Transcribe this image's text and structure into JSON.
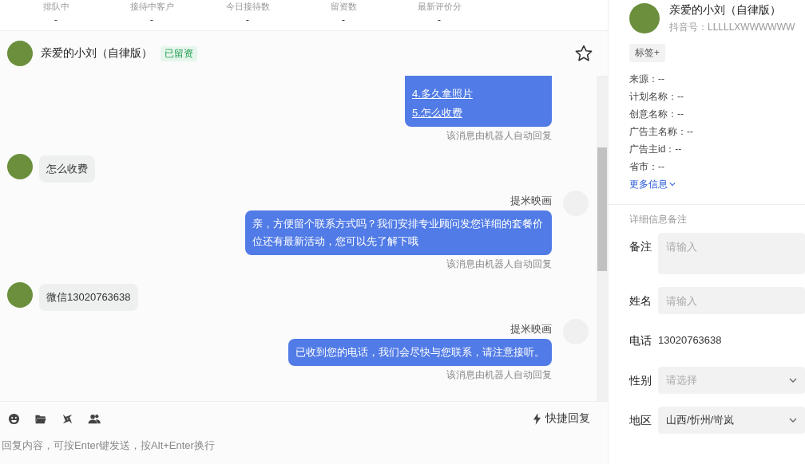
{
  "stats": [
    {
      "label": "排队中",
      "value": "-"
    },
    {
      "label": "接待中客户",
      "value": "-"
    },
    {
      "label": "今日接待数",
      "value": "-"
    },
    {
      "label": "留资数",
      "value": "-"
    },
    {
      "label": "最新评价分",
      "value": "-"
    }
  ],
  "chat_header": {
    "name": "亲爱的小刘（自律版）",
    "badge": "已留资",
    "starred": false
  },
  "messages": [
    {
      "kind": "menu",
      "items": [
        "4.多久拿照片",
        "5.怎么收费"
      ],
      "note": "该消息由机器人自动回复"
    },
    {
      "kind": "customer",
      "text": "怎么收费"
    },
    {
      "kind": "agent",
      "sender": "提米映画",
      "text": "亲，方便留个联系方式吗？我们安排专业顾问发您详细的套餐价位还有最新活动，您可以先了解下哦",
      "note": "该消息由机器人自动回复"
    },
    {
      "kind": "customer",
      "text": "微信13020763638"
    },
    {
      "kind": "agent",
      "sender": "提米映画",
      "text": "已收到您的电话，我们会尽快与您联系，请注意接听。",
      "note": "该消息由机器人自动回复"
    }
  ],
  "composer": {
    "quick_reply": "快捷回复",
    "placeholder": "回复内容，可按Enter键发送，按Alt+Enter换行"
  },
  "profile": {
    "name": "亲爱的小刘（自律版）",
    "douyin_id": "抖音号：LLLLLXWWWWWW",
    "tag_button": "标签+",
    "info": [
      "来源：--",
      "计划名称：--",
      "创意名称：--",
      "广告主名称：--",
      "广告主id：--",
      "省市：--"
    ],
    "more": "更多信息",
    "section_title": "详细信息备注",
    "fields": [
      {
        "kind": "textarea",
        "label": "备注",
        "placeholder": "请输入"
      },
      {
        "kind": "input",
        "label": "姓名",
        "placeholder": "请输入"
      },
      {
        "kind": "text",
        "label": "电话",
        "value": "13020763638"
      },
      {
        "kind": "select",
        "label": "性别",
        "placeholder": "请选择"
      },
      {
        "kind": "select",
        "label": "地区",
        "value": "山西/忻州/岢岚"
      }
    ]
  }
}
